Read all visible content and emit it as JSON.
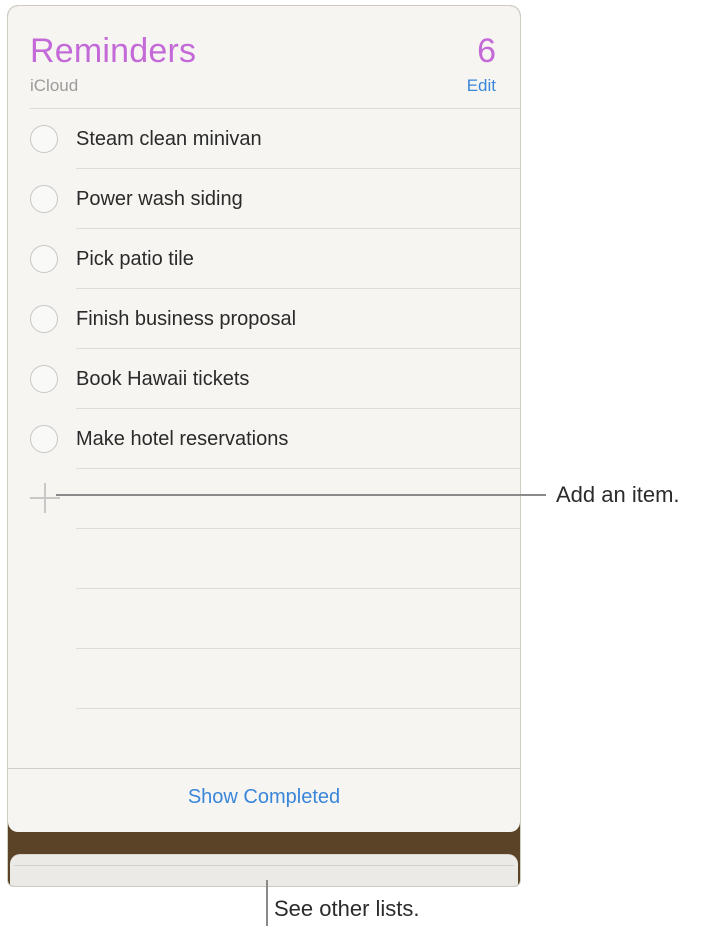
{
  "header": {
    "title": "Reminders",
    "count": "6",
    "account": "iCloud",
    "edit_label": "Edit"
  },
  "reminders": [
    {
      "text": "Steam clean minivan"
    },
    {
      "text": "Power wash siding"
    },
    {
      "text": "Pick patio tile"
    },
    {
      "text": "Finish business proposal"
    },
    {
      "text": "Book Hawaii tickets"
    },
    {
      "text": "Make hotel reservations"
    }
  ],
  "footer": {
    "show_completed_label": "Show Completed"
  },
  "annotations": {
    "add_item": "Add an item.",
    "other_lists": "See other lists."
  },
  "colors": {
    "accent_purple": "#c46ad8",
    "link_blue": "#3a86d9",
    "list_stack_brown": "#5a4327"
  },
  "icons": {
    "reminder_checkbox": "circle-icon",
    "add_item": "plus-icon"
  }
}
